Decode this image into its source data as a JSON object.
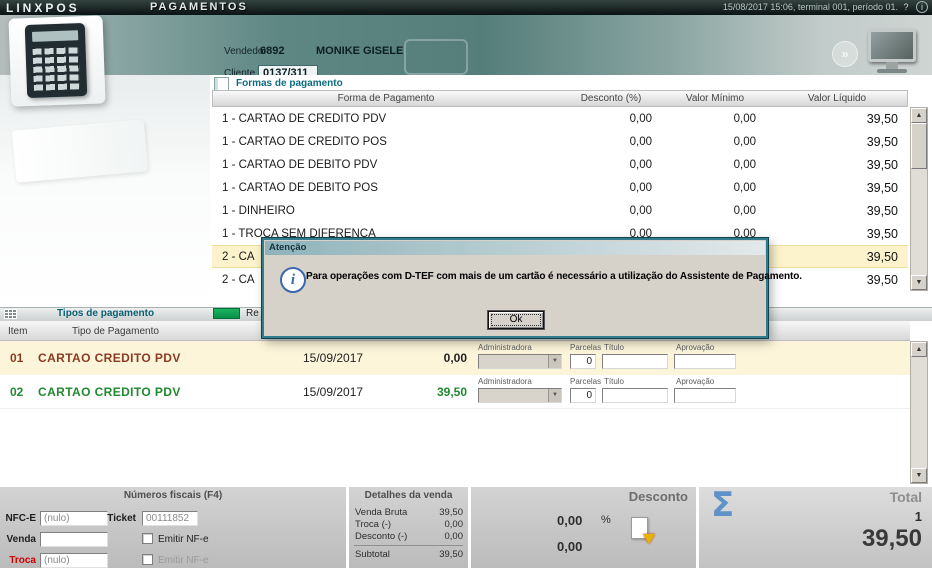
{
  "titlebar": {
    "logo": "LINXPOS",
    "title": "PAGAMENTOS",
    "status": "15/08/2017 15:06, terminal 001, período 01."
  },
  "icons": {
    "help": "?",
    "info": "i",
    "chevrons": "»",
    "scroll_up": "▲",
    "scroll_down": "▼",
    "combo_arrow": "▼"
  },
  "header": {
    "vendedor_label": "Vendedor",
    "vendedor_code": "6892",
    "vendedor_name": "MONIKE GISELE",
    "cliente_label": "Cliente",
    "cliente_code": "0137/311"
  },
  "formas": {
    "tab_label": "Formas de pagamento",
    "columns": [
      "Forma de Pagamento",
      "Desconto (%)",
      "Valor Mínimo",
      "Valor Líquido"
    ],
    "rows": [
      {
        "forma": "1 - CARTAO DE CREDITO PDV",
        "desconto": "0,00",
        "minimo": "0,00",
        "liquido": "39,50"
      },
      {
        "forma": "1 - CARTAO DE CREDITO POS",
        "desconto": "0,00",
        "minimo": "0,00",
        "liquido": "39,50"
      },
      {
        "forma": "1 - CARTAO DE DEBITO PDV",
        "desconto": "0,00",
        "minimo": "0,00",
        "liquido": "39,50"
      },
      {
        "forma": "1 - CARTAO DE DEBITO POS",
        "desconto": "0,00",
        "minimo": "0,00",
        "liquido": "39,50"
      },
      {
        "forma": "1 - DINHEIRO",
        "desconto": "0,00",
        "minimo": "0,00",
        "liquido": "39,50"
      },
      {
        "forma": "1 - TROCA SEM DIFERENCA",
        "desconto": "0,00",
        "minimo": "0,00",
        "liquido": "39,50"
      },
      {
        "forma": "2 - CA",
        "desconto": "",
        "minimo": "",
        "liquido": "39,50"
      },
      {
        "forma": "2 - CA",
        "desconto": "",
        "minimo": "",
        "liquido": "39,50"
      }
    ]
  },
  "dialog": {
    "title": "Atenção",
    "message": "Para operações com D-TEF com mais de um cartão é necessário a utilização do Assistente de Pagamento.",
    "ok_label": "Ok"
  },
  "tipos": {
    "tab_label": "Tipos de pagamento",
    "partial_label": "Re",
    "columns": {
      "item": "Item",
      "tipo": "Tipo de Pagamento"
    },
    "field_labels": {
      "administradora": "Administradora",
      "parcelas": "Parcelas",
      "titulo": "Título",
      "aprovacao": "Aprovação"
    },
    "rows": [
      {
        "item": "01",
        "tipo": "CARTAO CREDITO PDV",
        "data": "15/09/2017",
        "valor": "0,00",
        "parcelas": "0",
        "titulo": "",
        "aprovacao": ""
      },
      {
        "item": "02",
        "tipo": "CARTAO CREDITO PDV",
        "data": "15/09/2017",
        "valor": "39,50",
        "parcelas": "0",
        "titulo": "",
        "aprovacao": ""
      }
    ]
  },
  "fiscais": {
    "title": "Números fiscais (F4)",
    "nfce_label": "NFC-E",
    "nfce_value": "(nulo)",
    "ticket_label": "Ticket",
    "ticket_value": "00111852",
    "venda_label": "Venda",
    "venda_value": "",
    "emitir1_label": "Emitir NF-e",
    "troca_label": "Troca",
    "troca_value": "(nulo)",
    "emitir2_label": "Emitir NF-e"
  },
  "detalhes": {
    "title": "Detalhes da venda",
    "rows": [
      {
        "label": "Venda Bruta",
        "value": "39,50"
      },
      {
        "label": "Troca (-)",
        "value": "0,00"
      },
      {
        "label": "Desconto (-)",
        "value": "0,00"
      },
      {
        "label": "Subtotal",
        "value": "39,50"
      }
    ]
  },
  "desconto": {
    "title": "Desconto",
    "percent_value": "0,00",
    "percent_symbol": "%",
    "value": "0,00"
  },
  "total": {
    "title": "Total",
    "sigma_icon": "Σ",
    "count": "1",
    "value": "39,50"
  }
}
